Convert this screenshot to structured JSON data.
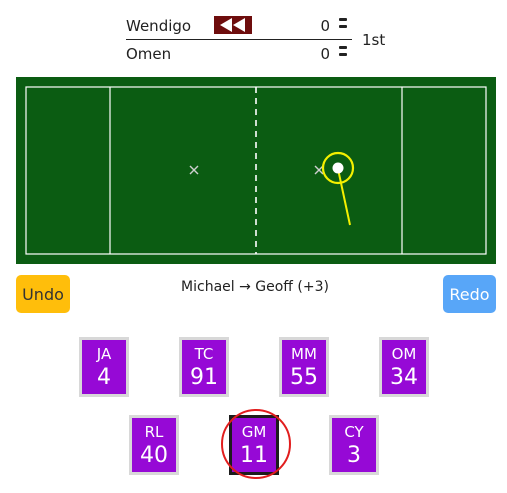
{
  "scoreboard": {
    "home": {
      "name": "Wendigo",
      "score": "0"
    },
    "away": {
      "name": "Omen",
      "score": "0"
    },
    "period": "1st",
    "rewind_icon": "double-chevron-left-icon"
  },
  "colors": {
    "field": "#0b5c12",
    "field_lines": "#ffffff",
    "ball_ring": "#f4f000",
    "rewind_button": "#6e0d0d",
    "undo_button": "#ffbe0b",
    "redo_button": "#58a6f8",
    "player_card": "#9609d6",
    "selection_ring": "#e11d1d"
  },
  "actions": {
    "undo_label": "Undo",
    "redo_label": "Redo",
    "last_action": "Michael → Geoff (+3)"
  },
  "players": [
    {
      "initials": "JA",
      "number": "4"
    },
    {
      "initials": "TC",
      "number": "91"
    },
    {
      "initials": "MM",
      "number": "55"
    },
    {
      "initials": "OM",
      "number": "34"
    },
    {
      "initials": "RL",
      "number": "40"
    },
    {
      "initials": "GM",
      "number": "11",
      "selected": true
    },
    {
      "initials": "CY",
      "number": "3"
    }
  ]
}
